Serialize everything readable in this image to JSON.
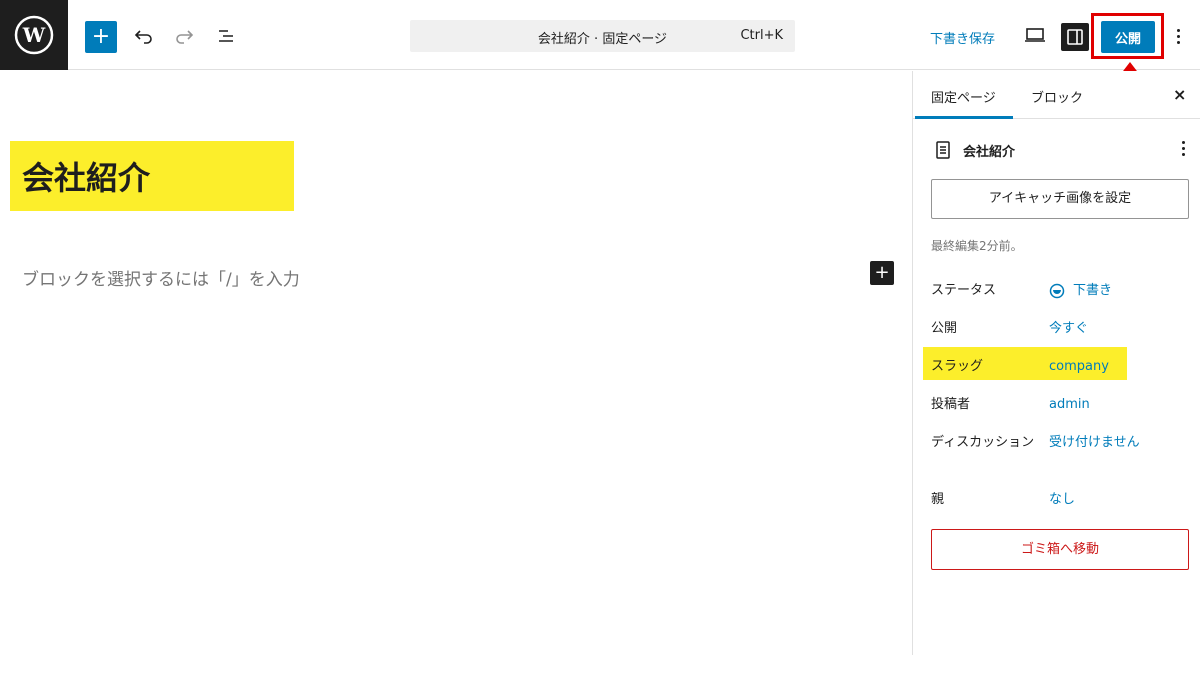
{
  "toolbar": {
    "logo_icon": "wordpress-icon",
    "add_label": "+",
    "undo_icon": "undo-icon",
    "redo_icon": "redo-icon",
    "outline_icon": "list-view-icon",
    "command_title": "会社紹介 · 固定ページ",
    "command_shortcut": "Ctrl+K",
    "save_draft_label": "下書き保存",
    "preview_icon": "desktop-icon",
    "settings_icon": "sidebar-icon",
    "publish_label": "公開",
    "more_icon": "more-vertical-icon"
  },
  "editor": {
    "title": "会社紹介",
    "placeholder": "ブロックを選択するには「/」を入力",
    "inline_add_label": "+"
  },
  "sidebar": {
    "tabs": [
      {
        "label": "固定ページ",
        "active": true
      },
      {
        "label": "ブロック",
        "active": false
      }
    ],
    "close_label": "×",
    "document_name": "会社紹介",
    "featured_image_label": "アイキャッチ画像を設定",
    "last_edited": "最終編集2分前。",
    "properties": [
      {
        "label": "ステータス",
        "value": "下書き"
      },
      {
        "label": "公開",
        "value": "今すぐ"
      },
      {
        "label": "スラッグ",
        "value": "company"
      },
      {
        "label": "投稿者",
        "value": "admin"
      },
      {
        "label": "ディスカッション",
        "value": "受け付けません"
      },
      {
        "label": "親",
        "value": "なし"
      }
    ],
    "trash_label": "ゴミ箱へ移動"
  },
  "colors": {
    "accent": "#007cba",
    "highlight": "#fcee2b",
    "annotation_red": "#e00000",
    "danger": "#cc1818"
  }
}
